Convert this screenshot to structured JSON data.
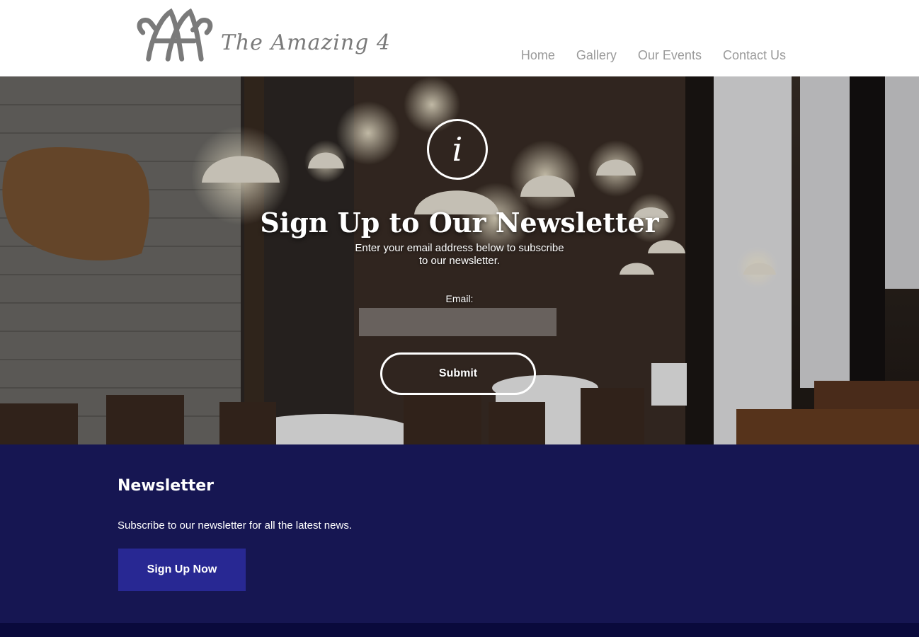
{
  "header": {
    "logo_text": "The Amazing 4",
    "nav": [
      {
        "label": "Home"
      },
      {
        "label": "Gallery"
      },
      {
        "label": "Our Events"
      },
      {
        "label": "Contact Us"
      }
    ]
  },
  "hero": {
    "icon": "info-icon",
    "icon_glyph": "i",
    "title": "Sign Up to Our Newsletter",
    "subtitle": "Enter your email address below to subscribe to our newsletter.",
    "email_label": "Email:",
    "email_value": "",
    "submit_label": "Submit"
  },
  "newsletter": {
    "title": "Newsletter",
    "description": "Subscribe to our newsletter for all the latest news.",
    "button_label": "Sign Up Now"
  },
  "colors": {
    "nav_text": "#9a9a9a",
    "newsletter_bg": "#161652",
    "signup_button_bg": "#282893",
    "footer_bg": "#0a0a3c"
  }
}
